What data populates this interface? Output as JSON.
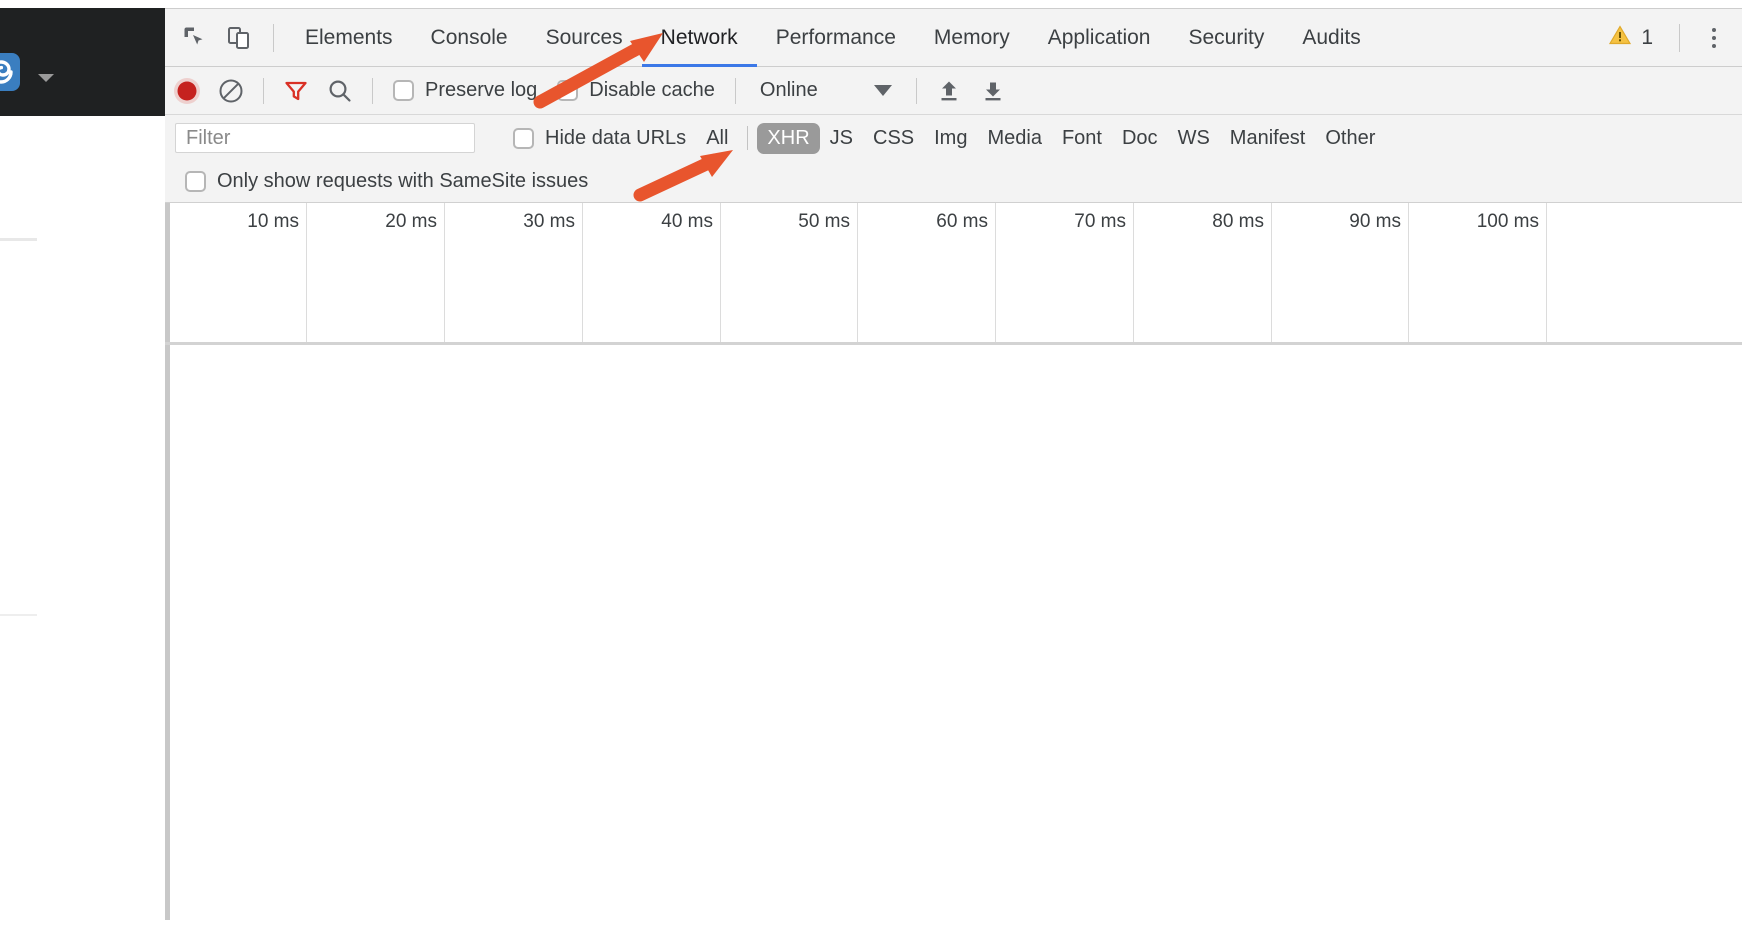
{
  "browser": {
    "extension_icon": "spiral-logo-icon",
    "extension_dropdown_icon": "chevron-down-icon"
  },
  "devtools": {
    "inspect_icon": "inspect-element-icon",
    "device_toolbar_icon": "device-toolbar-icon",
    "tabs": [
      {
        "label": "Elements",
        "active": false
      },
      {
        "label": "Console",
        "active": false
      },
      {
        "label": "Sources",
        "active": false
      },
      {
        "label": "Network",
        "active": true
      },
      {
        "label": "Performance",
        "active": false
      },
      {
        "label": "Memory",
        "active": false
      },
      {
        "label": "Application",
        "active": false
      },
      {
        "label": "Security",
        "active": false
      },
      {
        "label": "Audits",
        "active": false
      }
    ],
    "warning_icon": "warning-triangle-icon",
    "warning_count": "1",
    "more_icon": "kebab-menu-icon",
    "accent_color": "#3b78e7"
  },
  "toolbar": {
    "record_icon": "record-button-icon",
    "record_active": true,
    "clear_icon": "clear-no-entry-icon",
    "filter_icon": "filter-funnel-icon",
    "filter_active": true,
    "search_icon": "search-magnifier-icon",
    "preserve_log_label": "Preserve log",
    "preserve_log_checked": false,
    "disable_cache_label": "Disable cache",
    "disable_cache_checked": false,
    "throttle_value": "Online",
    "throttle_caret_icon": "triangle-down-icon",
    "import_har_icon": "upload-arrow-icon",
    "export_har_icon": "download-arrow-icon"
  },
  "filterbar": {
    "filter_placeholder": "Filter",
    "filter_value": "",
    "hide_data_urls_label": "Hide data URLs",
    "hide_data_urls_checked": false,
    "types": [
      {
        "label": "All",
        "selected": false
      },
      {
        "label": "XHR",
        "selected": true
      },
      {
        "label": "JS",
        "selected": false
      },
      {
        "label": "CSS",
        "selected": false
      },
      {
        "label": "Img",
        "selected": false
      },
      {
        "label": "Media",
        "selected": false
      },
      {
        "label": "Font",
        "selected": false
      },
      {
        "label": "Doc",
        "selected": false
      },
      {
        "label": "WS",
        "selected": false
      },
      {
        "label": "Manifest",
        "selected": false
      },
      {
        "label": "Other",
        "selected": false
      }
    ],
    "selected_chip_color": "#9a9a9a"
  },
  "samesite": {
    "label": "Only show requests with SameSite issues",
    "checked": false
  },
  "overview": {
    "ticks": [
      "10 ms",
      "20 ms",
      "30 ms",
      "40 ms",
      "50 ms",
      "60 ms",
      "70 ms",
      "80 ms",
      "90 ms",
      "100 ms"
    ]
  },
  "annotations": {
    "color": "#e8552d",
    "arrows": [
      {
        "name": "arrow-to-network-tab",
        "target": "Network"
      },
      {
        "name": "arrow-to-xhr-filter",
        "target": "XHR"
      }
    ]
  }
}
